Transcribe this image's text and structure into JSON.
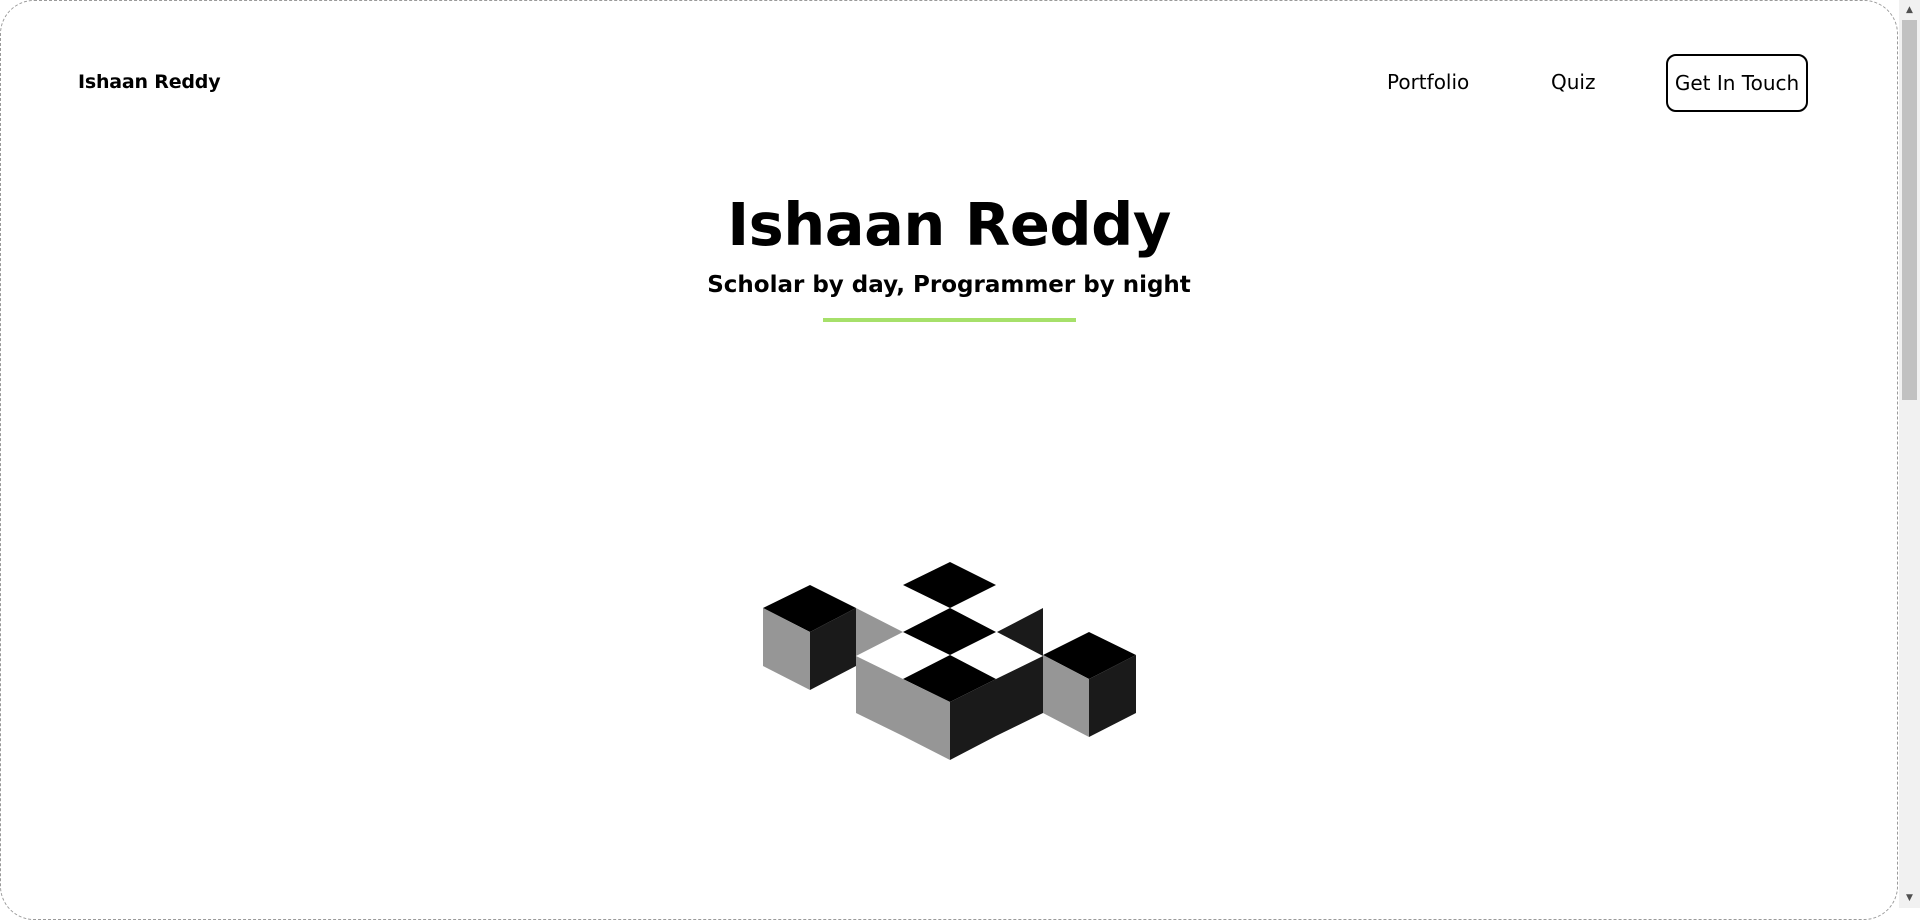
{
  "header": {
    "brand": "Ishaan Reddy",
    "nav": [
      {
        "label": "Portfolio"
      },
      {
        "label": "Quiz"
      }
    ],
    "cta_label": "Get In Touch"
  },
  "hero": {
    "title": "Ishaan Reddy",
    "subtitle": "Scholar by day, Programmer by night",
    "accent_color": "#a6e06a"
  },
  "illustration": {
    "icon": "isometric-cubes-logo",
    "colors": {
      "top": "#000000",
      "left": "#969696",
      "right": "#1a1a1a"
    }
  },
  "scrollbar": {
    "up_icon": "triangle-up",
    "down_icon": "triangle-down"
  }
}
